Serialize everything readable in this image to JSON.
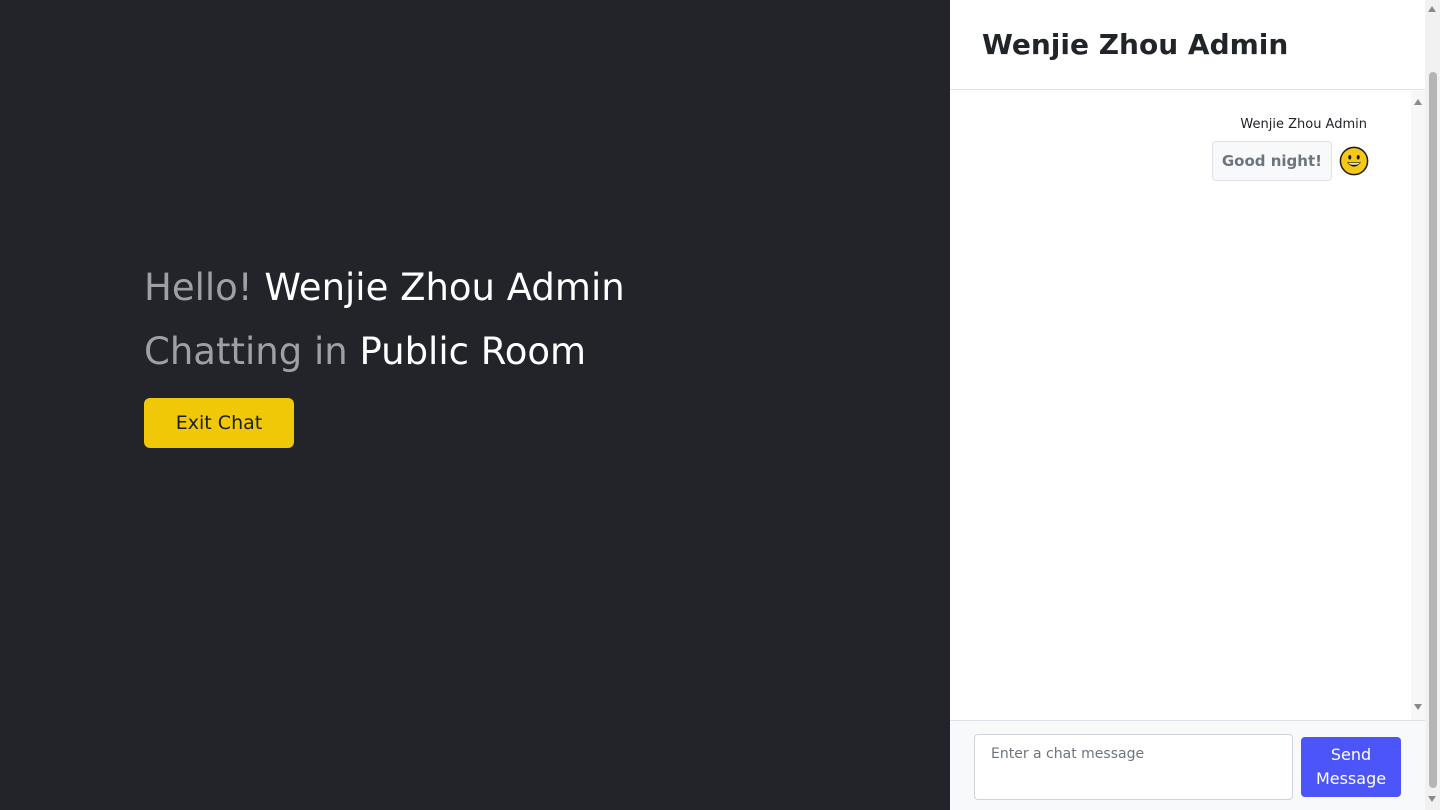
{
  "welcome": {
    "hello_prefix": "Hello!",
    "user_name": "Wenjie Zhou Admin",
    "chatting_prefix": "Chatting in",
    "room_name": "Public Room",
    "exit_label": "Exit Chat"
  },
  "chat": {
    "header_title": "Wenjie Zhou Admin",
    "messages": [
      {
        "author": "Wenjie Zhou Admin",
        "text": "Good night!",
        "icon": "grinning-face-icon"
      }
    ],
    "input_placeholder": "Enter a chat message",
    "input_value": "",
    "send_label": "Send\nMessage"
  },
  "colors": {
    "background_dark": "#222429",
    "exit_button": "#f0c808",
    "send_button": "#4b55fa"
  }
}
